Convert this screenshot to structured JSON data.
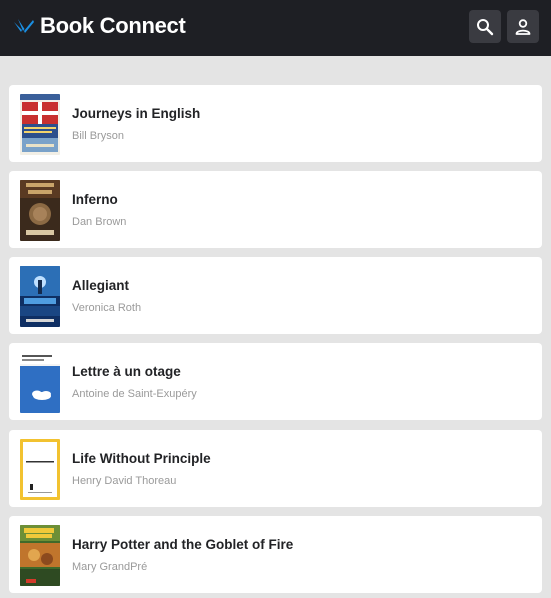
{
  "header": {
    "brand": "Book Connect",
    "icons": {
      "logo": "book-connect-logo-icon",
      "search": "search-icon",
      "profile": "user-icon"
    }
  },
  "books": [
    {
      "title": "Journeys in English",
      "author": "Bill Bryson",
      "cover_lettering": "Journeys in English"
    },
    {
      "title": "Inferno",
      "author": "Dan Brown",
      "cover_lettering": "DAN BROWN INFERNO"
    },
    {
      "title": "Allegiant",
      "author": "Veronica Roth",
      "cover_lettering": "ALLEGIANT"
    },
    {
      "title": "Lettre à un otage",
      "author": "Antoine de Saint-Exupéry",
      "cover_lettering": "Saint-Exupéry Lettre à un otage"
    },
    {
      "title": "Life Without Principle",
      "author": "Henry David Thoreau",
      "cover_lettering": "Life Without Principle"
    },
    {
      "title": "Harry Potter and the Goblet of Fire",
      "author": "Mary GrandPré",
      "cover_lettering": "Harry Potter"
    }
  ],
  "colors": {
    "header_bg": "#1e1f24",
    "page_bg": "#e4e4e4",
    "card_bg": "#ffffff",
    "logo_blue": "#1a8fe3"
  }
}
